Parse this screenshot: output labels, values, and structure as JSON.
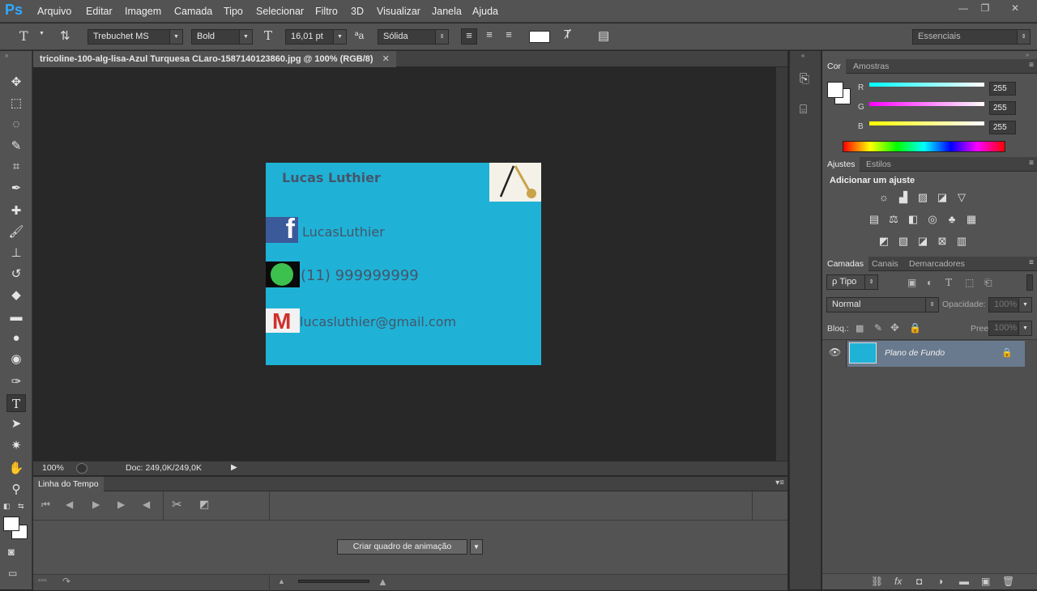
{
  "app": {
    "logo": "Ps"
  },
  "menu": [
    "Arquivo",
    "Editar",
    "Imagem",
    "Camada",
    "Tipo",
    "Selecionar",
    "Filtro",
    "3D",
    "Visualizar",
    "Janela",
    "Ajuda"
  ],
  "window_controls": {
    "minimize": "—",
    "restore": "❐",
    "close": "✕"
  },
  "options": {
    "tool_glyph": "T",
    "font_family": "Trebuchet MS",
    "font_style": "Bold",
    "font_size": "16,01 pt",
    "aa_label": "ªa",
    "antialias": "Sólida",
    "workspace": "Essenciais"
  },
  "document": {
    "tab_title": "tricoline-100-alg-lisa-Azul Turquesa CLaro-1587140123860.jpg @ 100% (RGB/8)",
    "tab_close": "✕",
    "zoom": "100%",
    "doc_info": "Doc: 249,0K/249,0K",
    "status_arrow": "▶",
    "card": {
      "name": "Lucas Luthier",
      "facebook": "LucasLuthier",
      "facebook_icon_letter": "f",
      "phone": "(11) 999999999",
      "email": "lucasluthier@gmail.com",
      "gmail_letter": "M",
      "background_color": "#1fb2d6"
    }
  },
  "timeline": {
    "title": "Linha do Tempo",
    "create_button": "Criar quadro de animação"
  },
  "color_panel": {
    "tabs": [
      "Cor",
      "Amostras"
    ],
    "channels": [
      {
        "label": "R",
        "value": "255",
        "color": "#00ffff"
      },
      {
        "label": "G",
        "value": "255",
        "color": "#ff00ff"
      },
      {
        "label": "B",
        "value": "255",
        "color": "#ffff00"
      }
    ]
  },
  "adjustments_panel": {
    "tabs": [
      "Ajustes",
      "Estilos"
    ],
    "subtitle": "Adicionar um ajuste"
  },
  "layers_panel": {
    "tabs": [
      "Camadas",
      "Canais",
      "Demarcadores"
    ],
    "filter_kind": "ρ Tipo",
    "blend_mode": "Normal",
    "opacity_label": "Opacidade:",
    "opacity_value": "100%",
    "lock_label": "Bloq.:",
    "fill_label": "Preen.:",
    "fill_value": "100%",
    "layers": [
      {
        "name": "Plano de Fundo",
        "visible": true,
        "locked": true
      }
    ],
    "footer_icons": [
      "link-icon",
      "fx-icon",
      "mask-icon",
      "adjustment-icon",
      "folder-icon",
      "new-layer-icon",
      "trash-icon"
    ],
    "footer_glyphs": [
      "⛓",
      "fx",
      "◘",
      "◑",
      "▬",
      "▣",
      "🗑"
    ]
  },
  "tools": [
    "move",
    "marquee",
    "lasso",
    "quick-select",
    "crop",
    "eyedropper",
    "healing",
    "brush",
    "stamp",
    "history-brush",
    "eraser",
    "gradient",
    "blur",
    "dodge",
    "pen",
    "type",
    "path-select",
    "shape",
    "hand",
    "zoom"
  ]
}
